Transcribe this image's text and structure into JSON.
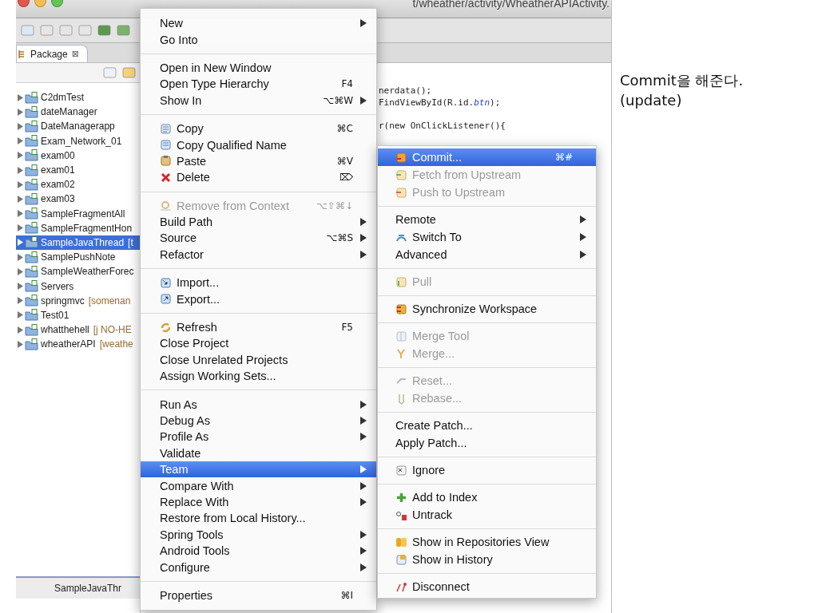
{
  "window": {
    "path": "t/wheather/activity/WheatherAPIActivity."
  },
  "package_explorer": {
    "tab": "Package",
    "close": "⊠",
    "items": [
      {
        "label": "C2dmTest",
        "selected": false
      },
      {
        "label": "dateManager",
        "selected": false
      },
      {
        "label": "DateManagerapp",
        "selected": false
      },
      {
        "label": "Exam_Network_01",
        "selected": false
      },
      {
        "label": "exam00",
        "selected": false
      },
      {
        "label": "exam01",
        "selected": false
      },
      {
        "label": "exam02",
        "selected": false
      },
      {
        "label": "exam03",
        "selected": false
      },
      {
        "label": "SampleFragmentAll",
        "selected": false
      },
      {
        "label": "SampleFragmentHon",
        "selected": false
      },
      {
        "label": "SampleJavaThread",
        "decoration": "[t",
        "selected": true
      },
      {
        "label": "SamplePushNote",
        "selected": false
      },
      {
        "label": "SampleWeatherForec",
        "selected": false
      },
      {
        "label": "Servers",
        "selected": false
      },
      {
        "label": "springmvc",
        "decoration": "[somenan",
        "selected": false
      },
      {
        "label": "Test01",
        "selected": false
      },
      {
        "label": "whatthehell",
        "decoration": "[j NO-HE",
        "selected": false
      },
      {
        "label": "wheatherAPI",
        "decoration": "[weathe",
        "selected": false
      }
    ]
  },
  "status_bar": {
    "text": "SampleJavaThr"
  },
  "editor": {
    "code_lines": [
      "nerdata();",
      "FindViewById(R.id.**btn**);",
      "r(new OnClickListener(){"
    ]
  },
  "context_menu": {
    "groups": [
      [
        {
          "label": "New",
          "submenu": true,
          "disabled": false,
          "selected": false
        },
        {
          "label": "Go Into",
          "submenu": false,
          "disabled": false,
          "selected": false
        }
      ],
      [
        {
          "label": "Open in New Window",
          "submenu": false,
          "disabled": false,
          "selected": false
        },
        {
          "label": "Open Type Hierarchy",
          "shortcut": "F4",
          "submenu": false,
          "disabled": false,
          "selected": false
        },
        {
          "label": "Show In",
          "shortcut": "⌥⌘W",
          "submenu": true,
          "disabled": false,
          "selected": false
        }
      ],
      [
        {
          "label": "Copy",
          "shortcut": "⌘C",
          "submenu": false,
          "disabled": false,
          "selected": false
        },
        {
          "label": "Copy Qualified Name",
          "submenu": false,
          "disabled": false,
          "selected": false
        },
        {
          "label": "Paste",
          "shortcut": "⌘V",
          "submenu": false,
          "disabled": false,
          "selected": false
        },
        {
          "label": "Delete",
          "shortcut": "⌦",
          "submenu": false,
          "disabled": false,
          "selected": false
        }
      ],
      [
        {
          "label": "Remove from Context",
          "shortcut": "⌥⇧⌘↓",
          "submenu": false,
          "disabled": true,
          "selected": false
        },
        {
          "label": "Build Path",
          "submenu": true,
          "disabled": false,
          "selected": false
        },
        {
          "label": "Source",
          "shortcut": "⌥⌘S",
          "submenu": true,
          "disabled": false,
          "selected": false
        },
        {
          "label": "Refactor",
          "submenu": true,
          "disabled": false,
          "selected": false
        }
      ],
      [
        {
          "label": "Import...",
          "submenu": false,
          "disabled": false,
          "selected": false
        },
        {
          "label": "Export...",
          "submenu": false,
          "disabled": false,
          "selected": false
        }
      ],
      [
        {
          "label": "Refresh",
          "shortcut": "F5",
          "submenu": false,
          "disabled": false,
          "selected": false
        },
        {
          "label": "Close Project",
          "submenu": false,
          "disabled": false,
          "selected": false
        },
        {
          "label": "Close Unrelated Projects",
          "submenu": false,
          "disabled": false,
          "selected": false
        },
        {
          "label": "Assign Working Sets...",
          "submenu": false,
          "disabled": false,
          "selected": false
        }
      ],
      [
        {
          "label": "Run As",
          "submenu": true,
          "disabled": false,
          "selected": false
        },
        {
          "label": "Debug As",
          "submenu": true,
          "disabled": false,
          "selected": false
        },
        {
          "label": "Profile As",
          "submenu": true,
          "disabled": false,
          "selected": false
        },
        {
          "label": "Validate",
          "submenu": false,
          "disabled": false,
          "selected": false
        },
        {
          "label": "Team",
          "submenu": true,
          "disabled": false,
          "selected": true
        },
        {
          "label": "Compare With",
          "submenu": true,
          "disabled": false,
          "selected": false
        },
        {
          "label": "Replace With",
          "submenu": true,
          "disabled": false,
          "selected": false
        },
        {
          "label": "Restore from Local History...",
          "submenu": false,
          "disabled": false,
          "selected": false
        },
        {
          "label": "Spring Tools",
          "submenu": true,
          "disabled": false,
          "selected": false
        },
        {
          "label": "Android Tools",
          "submenu": true,
          "disabled": false,
          "selected": false
        },
        {
          "label": "Configure",
          "submenu": true,
          "disabled": false,
          "selected": false
        }
      ],
      [
        {
          "label": "Properties",
          "shortcut": "⌘I",
          "submenu": false,
          "disabled": false,
          "selected": false
        }
      ]
    ]
  },
  "team_submenu": {
    "groups": [
      [
        {
          "label": "Commit...",
          "shortcut": "⌘#",
          "submenu": false,
          "disabled": false,
          "selected": true
        },
        {
          "label": "Fetch from Upstream",
          "submenu": false,
          "disabled": true,
          "selected": false
        },
        {
          "label": "Push to Upstream",
          "submenu": false,
          "disabled": true,
          "selected": false
        }
      ],
      [
        {
          "label": "Remote",
          "submenu": true,
          "disabled": false,
          "selected": false
        },
        {
          "label": "Switch To",
          "submenu": true,
          "disabled": false,
          "selected": false
        },
        {
          "label": "Advanced",
          "submenu": true,
          "disabled": false,
          "selected": false
        }
      ],
      [
        {
          "label": "Pull",
          "submenu": false,
          "disabled": true,
          "selected": false
        }
      ],
      [
        {
          "label": "Synchronize Workspace",
          "submenu": false,
          "disabled": false,
          "selected": false
        }
      ],
      [
        {
          "label": "Merge Tool",
          "submenu": false,
          "disabled": true,
          "selected": false
        },
        {
          "label": "Merge...",
          "submenu": false,
          "disabled": true,
          "selected": false
        }
      ],
      [
        {
          "label": "Reset...",
          "submenu": false,
          "disabled": true,
          "selected": false
        },
        {
          "label": "Rebase...",
          "submenu": false,
          "disabled": true,
          "selected": false
        }
      ],
      [
        {
          "label": "Create Patch...",
          "submenu": false,
          "disabled": false,
          "selected": false
        },
        {
          "label": "Apply Patch...",
          "submenu": false,
          "disabled": false,
          "selected": false
        }
      ],
      [
        {
          "label": "Ignore",
          "submenu": false,
          "disabled": false,
          "selected": false
        }
      ],
      [
        {
          "label": "Add to Index",
          "submenu": false,
          "disabled": false,
          "selected": false
        },
        {
          "label": "Untrack",
          "submenu": false,
          "disabled": false,
          "selected": false
        }
      ],
      [
        {
          "label": "Show in Repositories View",
          "submenu": false,
          "disabled": false,
          "selected": false
        },
        {
          "label": "Show in History",
          "submenu": false,
          "disabled": false,
          "selected": false
        }
      ],
      [
        {
          "label": "Disconnect",
          "submenu": false,
          "disabled": false,
          "selected": false
        }
      ]
    ]
  },
  "annotation": {
    "lines": [
      "Commit을 해준다.",
      "(update)"
    ]
  }
}
